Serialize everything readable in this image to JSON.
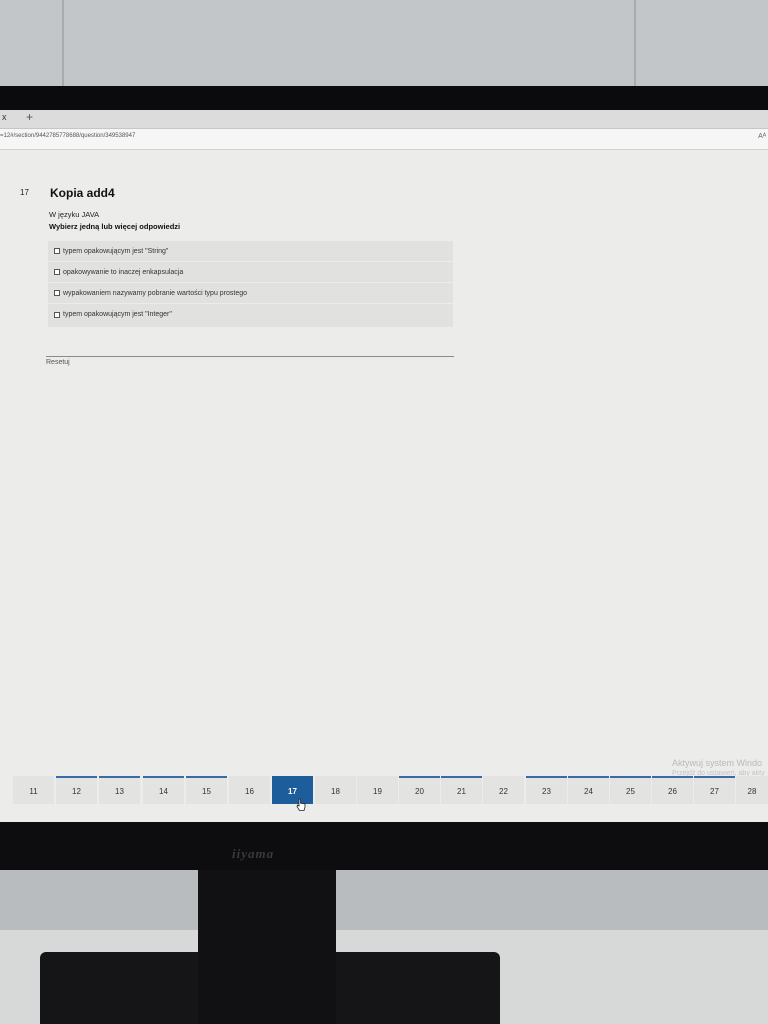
{
  "browser": {
    "tab_close": "x",
    "new_tab": "+",
    "url": "=12#/section/9442785778688/question/349538947",
    "reader_mode": "Aᴬ"
  },
  "question": {
    "number": "17",
    "title": "Kopia add4",
    "text": "W języku JAVA",
    "prompt": "Wybierz jedną lub więcej odpowiedzi",
    "options": [
      {
        "label": "typem opakowującym jest \"String\"",
        "checked": false
      },
      {
        "label": "opakowywanie to inaczej enkapsulacja",
        "checked": false
      },
      {
        "label": "wypakowaniem nazywamy pobranie wartości typu prostego",
        "checked": false
      },
      {
        "label": "typem opakowującym jest \"Integer\"",
        "checked": false
      }
    ],
    "reset_label": "Resetuj"
  },
  "watermark": {
    "line1": "Aktywuj system Windo",
    "line2": "Przejdź do ustawień, aby akty"
  },
  "pagination": {
    "pages": [
      "11",
      "12",
      "13",
      "14",
      "15",
      "16",
      "17",
      "18",
      "19",
      "20",
      "21",
      "22",
      "23",
      "24",
      "25",
      "26",
      "27",
      "28"
    ],
    "current": "17",
    "accent": "#1d5d9b"
  },
  "monitor": {
    "brand": "iiyama"
  }
}
